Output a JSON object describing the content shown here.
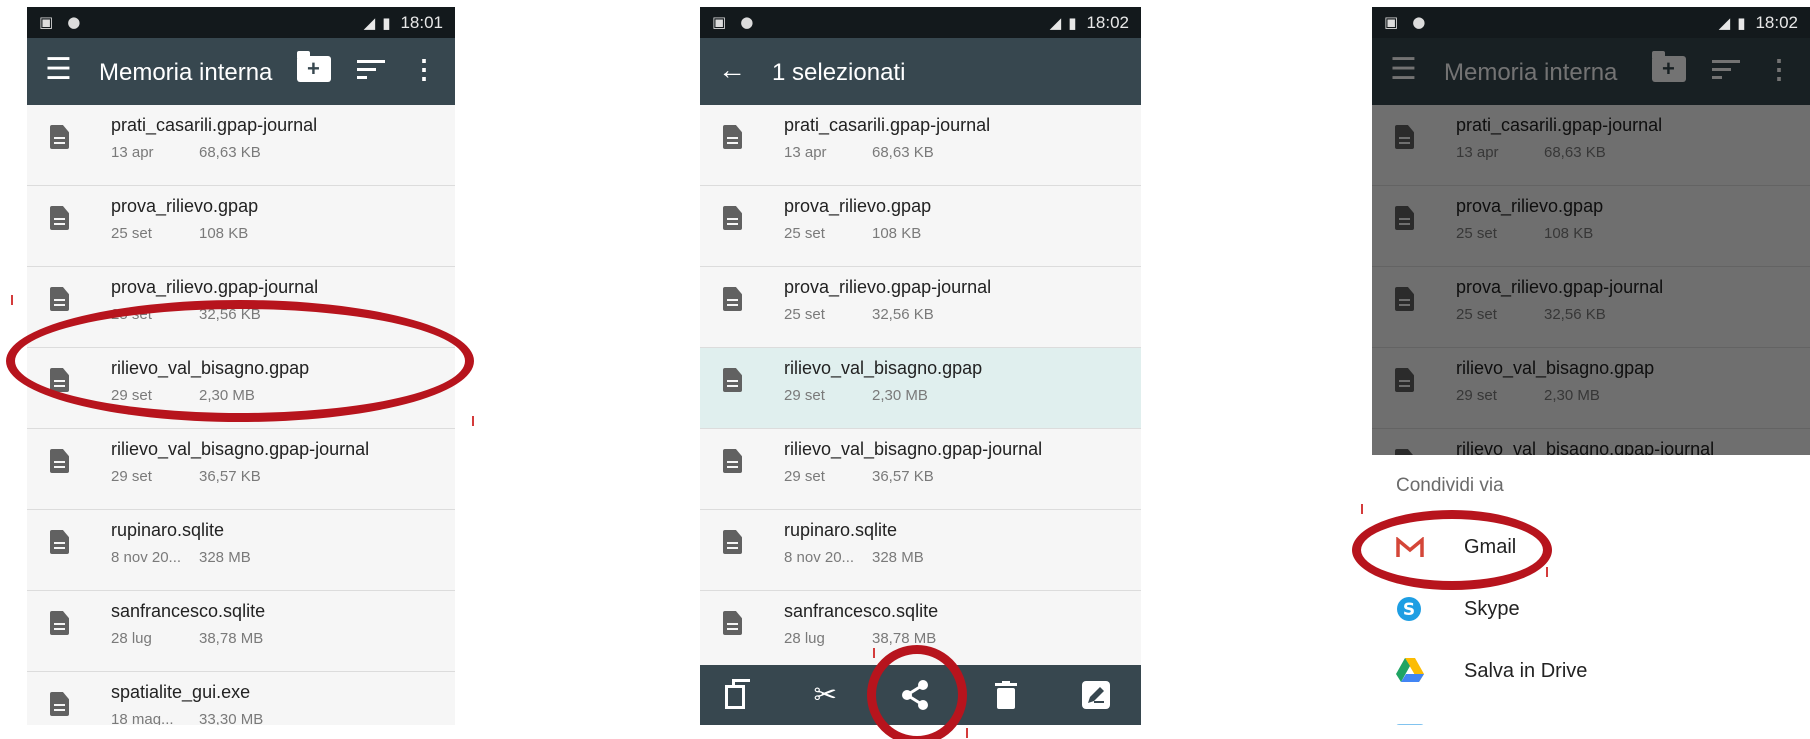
{
  "status_bar": [
    {
      "time": "18:01"
    },
    {
      "time": "18:02"
    },
    {
      "time": "18:02"
    }
  ],
  "toolbar": {
    "title": "Memoria interna",
    "selection_title": "1 selezionati"
  },
  "files_p1": [
    {
      "name": "prati_casarili.gpap-journal",
      "date": "13 apr",
      "size": "68,63 KB"
    },
    {
      "name": "prova_rilievo.gpap",
      "date": "25 set",
      "size": "108 KB"
    },
    {
      "name": "prova_rilievo.gpap-journal",
      "date": "25 set",
      "size": "32,56 KB"
    },
    {
      "name": "rilievo_val_bisagno.gpap",
      "date": "29 set",
      "size": "2,30 MB"
    },
    {
      "name": "rilievo_val_bisagno.gpap-journal",
      "date": "29 set",
      "size": "36,57 KB"
    },
    {
      "name": "rupinaro.sqlite",
      "date": "8 nov 20...",
      "size": "328 MB"
    },
    {
      "name": "sanfrancesco.sqlite",
      "date": "28 lug",
      "size": "38,78 MB"
    },
    {
      "name": "spatialite_gui.exe",
      "date": "18 mag...",
      "size": "33,30 MB"
    }
  ],
  "files_p2": [
    {
      "name": "prati_casarili.gpap-journal",
      "date": "13 apr",
      "size": "68,63 KB"
    },
    {
      "name": "prova_rilievo.gpap",
      "date": "25 set",
      "size": "108 KB"
    },
    {
      "name": "prova_rilievo.gpap-journal",
      "date": "25 set",
      "size": "32,56 KB"
    },
    {
      "name": "rilievo_val_bisagno.gpap",
      "date": "29 set",
      "size": "2,30 MB"
    },
    {
      "name": "rilievo_val_bisagno.gpap-journal",
      "date": "29 set",
      "size": "36,57 KB"
    },
    {
      "name": "rupinaro.sqlite",
      "date": "8 nov 20...",
      "size": "328 MB"
    },
    {
      "name": "sanfrancesco.sqlite",
      "date": "28 lug",
      "size": "38,78 MB"
    }
  ],
  "files_p3": [
    {
      "name": "prati_casarili.gpap-journal",
      "date": "13 apr",
      "size": "68,63 KB"
    },
    {
      "name": "prova_rilievo.gpap",
      "date": "25 set",
      "size": "108 KB"
    },
    {
      "name": "prova_rilievo.gpap-journal",
      "date": "25 set",
      "size": "32,56 KB"
    },
    {
      "name": "rilievo_val_bisagno.gpap",
      "date": "29 set",
      "size": "2,30 MB"
    },
    {
      "name": "rilievo_val_bisagno.gpap-journal",
      "date": "",
      "size": ""
    }
  ],
  "share_sheet": {
    "title": "Condividi via",
    "apps": [
      {
        "label": "Gmail",
        "icon": "gmail-icon"
      },
      {
        "label": "Skype",
        "icon": "skype-icon"
      },
      {
        "label": "Salva in Drive",
        "icon": "drive-icon"
      }
    ]
  },
  "action_icons": [
    "copy-icon",
    "cut-icon",
    "share-icon",
    "delete-icon",
    "rename-icon"
  ],
  "colors": {
    "toolbar": "#37474f",
    "status_bar": "#13191c",
    "selected_row": "#e0efee",
    "annotation": "#b7141d"
  }
}
